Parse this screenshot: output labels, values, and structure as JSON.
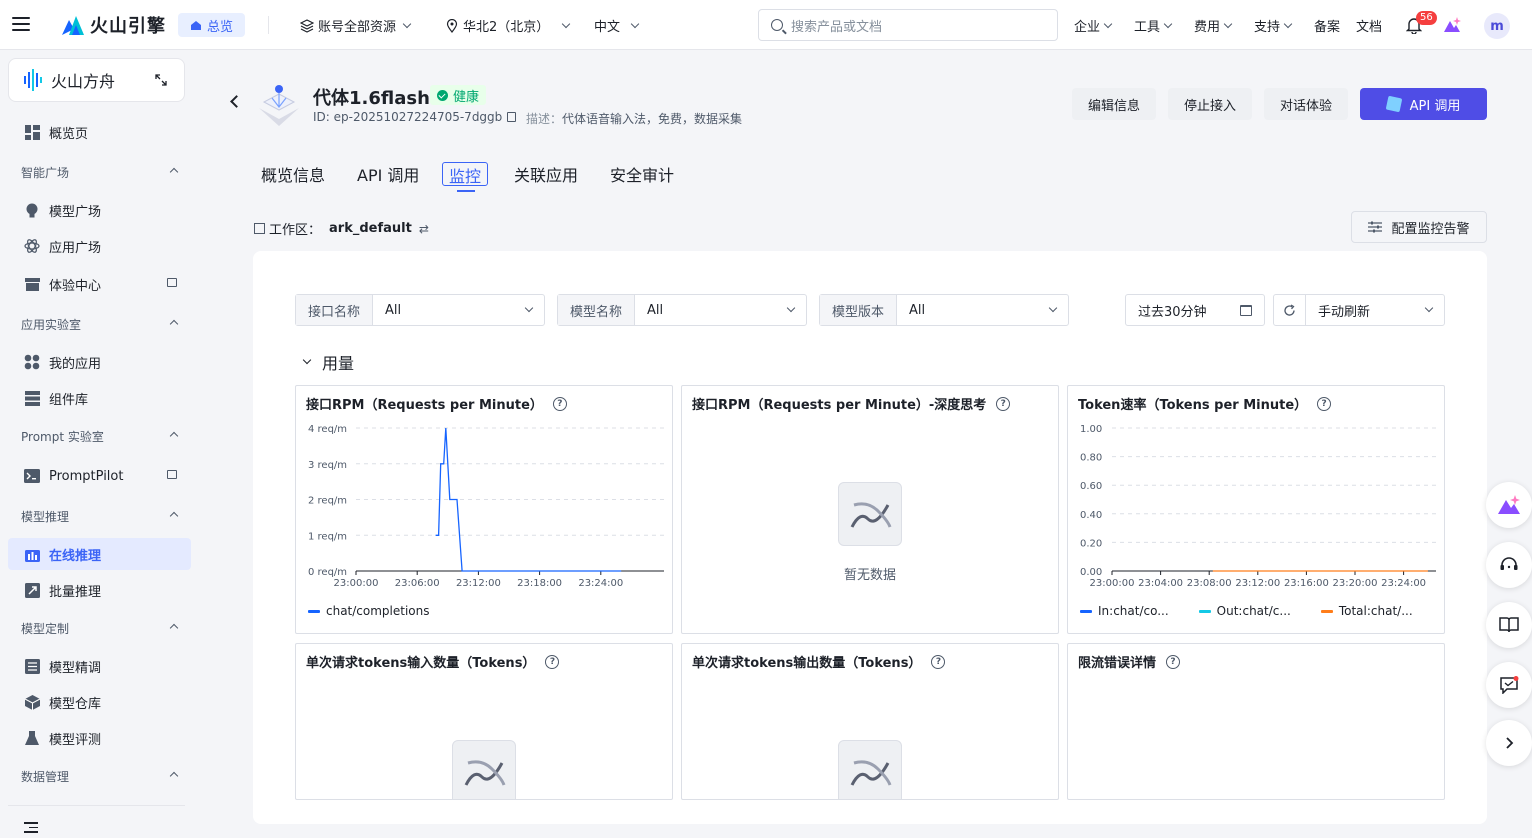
{
  "topbar": {
    "brand": "火山引擎",
    "home": "总览",
    "resources": "账号全部资源",
    "region": "华北2（北京）",
    "language": "中文",
    "search_placeholder": "搜索产品或文档",
    "nav": [
      "企业",
      "工具",
      "费用",
      "支持",
      "备案",
      "文档"
    ],
    "notif_count": "56",
    "avatar": "m"
  },
  "sidebar": {
    "product": "火山方舟",
    "overview": "概览页",
    "groups": [
      {
        "label": "智能广场",
        "items": [
          "模型广场",
          "应用广场",
          "体验中心"
        ]
      },
      {
        "label": "应用实验室",
        "items": [
          "我的应用",
          "组件库"
        ]
      },
      {
        "label": "Prompt 实验室",
        "items": [
          "PromptPilot"
        ]
      },
      {
        "label": "模型推理",
        "items": [
          "在线推理",
          "批量推理"
        ]
      },
      {
        "label": "模型定制",
        "items": [
          "模型精调",
          "模型仓库",
          "模型评测"
        ]
      },
      {
        "label": "数据管理",
        "items": []
      }
    ]
  },
  "endpoint": {
    "name": "代体1.6flash",
    "status": "健康",
    "id": "ID: ep-20251027224705-7dggb",
    "desc_label": "描述：",
    "desc": "代体语音输入法，免费，数据采集",
    "buttons": [
      "编辑信息",
      "停止接入",
      "对话体验"
    ],
    "api_button": "API 调用"
  },
  "tabs": [
    "概览信息",
    "API 调用",
    "监控",
    "关联应用",
    "安全审计"
  ],
  "workspace": {
    "label": "工作区：",
    "value": "ark_default"
  },
  "alert_button": "配置监控告警",
  "filters": [
    {
      "label": "接口名称",
      "value": "All"
    },
    {
      "label": "模型名称",
      "value": "All"
    },
    {
      "label": "模型版本",
      "value": "All"
    }
  ],
  "time_range": "过去30分钟",
  "refresh": "手动刷新",
  "section": "用量",
  "cards": {
    "rpm": "接口RPM（Requests per Minute）",
    "rpm_think": "接口RPM（Requests per Minute）-深度思考",
    "tpm": "Token速率（Tokens per Minute）",
    "in_tokens": "单次请求tokens输入数量（Tokens）",
    "out_tokens": "单次请求tokens输出数量（Tokens）",
    "rate_limit": "限流错误详情"
  },
  "no_data": "暂无数据",
  "chart_data": [
    {
      "type": "line",
      "title": "接口RPM（Requests per Minute）",
      "x_ticks": [
        "23:00:00",
        "23:06:00",
        "23:12:00",
        "23:18:00",
        "23:24:00"
      ],
      "y_ticks": [
        "0 req/m",
        "1 req/m",
        "2 req/m",
        "3 req/m",
        "4 req/m"
      ],
      "ylim": [
        0,
        4
      ],
      "series": [
        {
          "name": "chat/completions",
          "color": "#1664ff",
          "points": [
            [
              7.8,
              1
            ],
            [
              8.1,
              1
            ],
            [
              8.3,
              3
            ],
            [
              8.6,
              3
            ],
            [
              8.8,
              4
            ],
            [
              9.2,
              2
            ],
            [
              9.9,
              2
            ],
            [
              10.4,
              0
            ],
            [
              26.0,
              0
            ]
          ]
        }
      ]
    },
    {
      "type": "line",
      "title": "Token速率（Tokens per Minute）",
      "x_ticks": [
        "23:00:00",
        "23:04:00",
        "23:08:00",
        "23:12:00",
        "23:16:00",
        "23:20:00",
        "23:24:00"
      ],
      "y_ticks": [
        "0.00",
        "0.20",
        "0.40",
        "0.60",
        "0.80",
        "1.00"
      ],
      "ylim": [
        0,
        1
      ],
      "series": [
        {
          "name": "In:chat/co...",
          "color": "#1664ff"
        },
        {
          "name": "Out:chat/c...",
          "color": "#14c9e6"
        },
        {
          "name": "Total:chat/...",
          "color": "#ff7d1a",
          "points": [
            [
              8.3,
              0
            ],
            [
              26.0,
              0
            ]
          ]
        }
      ]
    }
  ]
}
